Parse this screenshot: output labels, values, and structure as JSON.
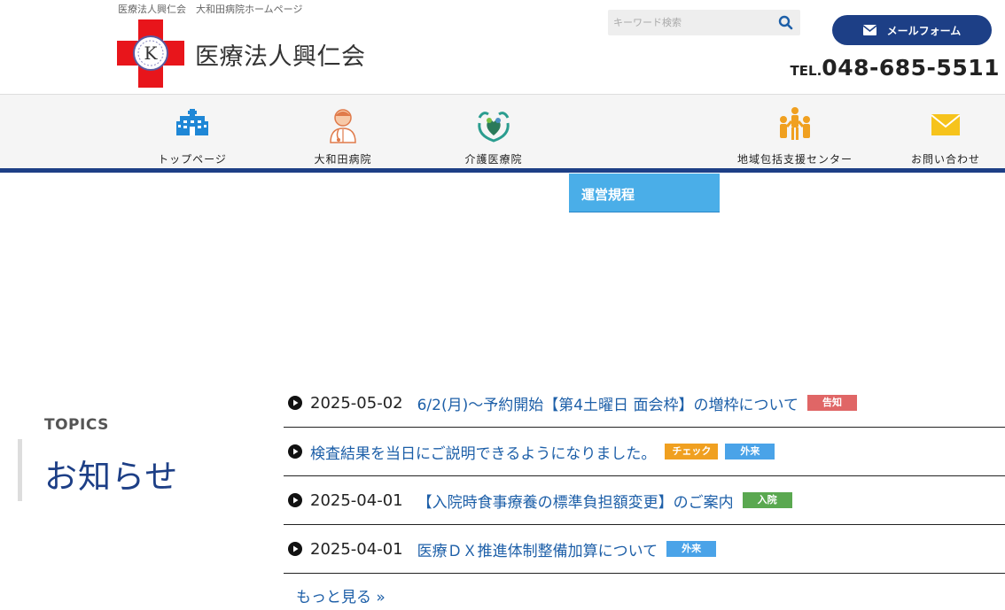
{
  "header": {
    "tagline": "医療法人興仁会　大和田病院ホームページ",
    "logo_letter": "K",
    "site_title": "医療法人興仁会",
    "search_placeholder": "キーワード検索",
    "mail_button": "メールフォーム",
    "tel_prefix": "TEL.",
    "tel_number": "048-685-5511"
  },
  "nav": {
    "items": [
      {
        "label": "トップページ",
        "icon": "hospital-building-icon"
      },
      {
        "label": "大和田病院",
        "icon": "doctor-icon"
      },
      {
        "label": "介護医療院",
        "icon": "care-hands-icon"
      },
      {
        "label": "地域包括支援センター",
        "icon": "community-people-icon"
      },
      {
        "label": "お問い合わせ",
        "icon": "envelope-icon"
      }
    ],
    "dropdown_item": "運営規程"
  },
  "topics": {
    "heading_en": "TOPICS",
    "heading_jp": "お知らせ",
    "items": [
      {
        "date": "2025-05-02",
        "title": "6/2(月)～予約開始【第4土曜日 面会枠】の増枠について",
        "badges": [
          {
            "label": "告知",
            "color": "#e06666"
          }
        ]
      },
      {
        "date": "",
        "title": "検査結果を当日にご説明できるようになりました。",
        "badges": [
          {
            "label": "チェック",
            "color": "#f0a020"
          },
          {
            "label": "外来",
            "color": "#4aa3e8"
          }
        ]
      },
      {
        "date": "2025-04-01",
        "title": "【入院時食事療養の標準負担額変更】のご案内",
        "badges": [
          {
            "label": "入院",
            "color": "#5aa850"
          }
        ]
      },
      {
        "date": "2025-04-01",
        "title": "医療ＤＸ推進体制整備加算について",
        "badges": [
          {
            "label": "外来",
            "color": "#4aa3e8"
          }
        ]
      }
    ],
    "more_label": "もっと見る »"
  },
  "colors": {
    "brand": "#1d3f86",
    "link": "#1d5fa8",
    "dropdown": "#4aaee8"
  }
}
